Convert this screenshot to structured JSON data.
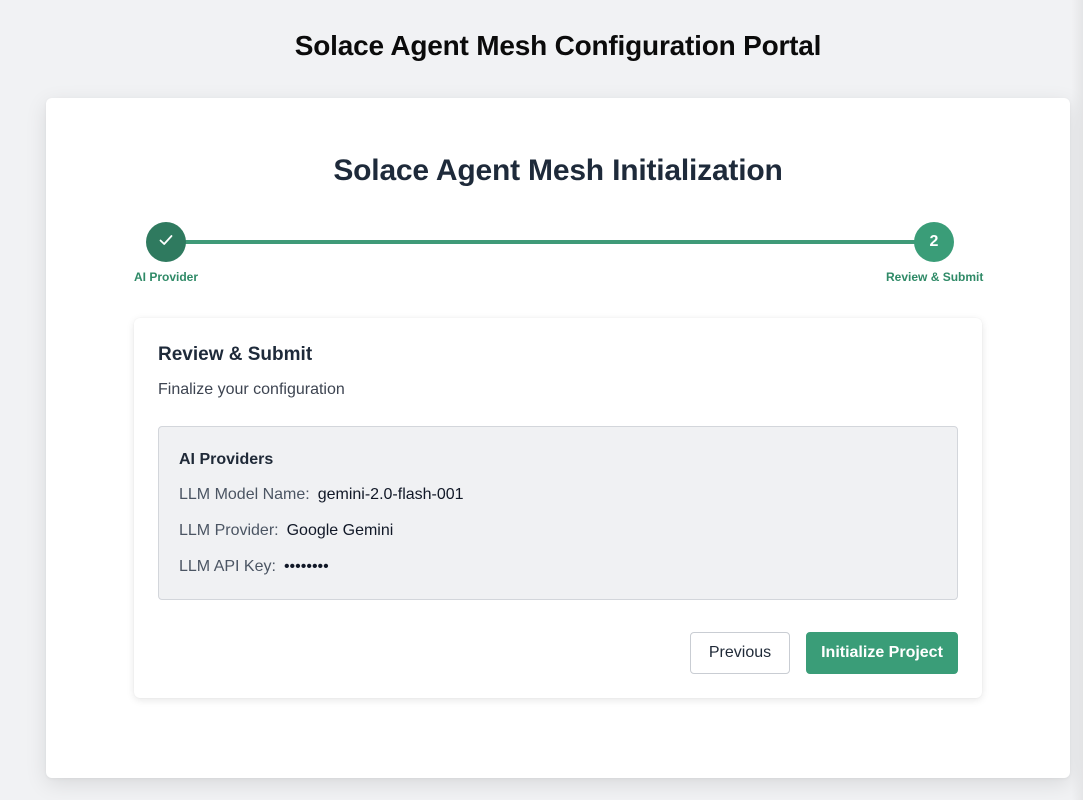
{
  "portal": {
    "title": "Solace Agent Mesh Configuration Portal"
  },
  "wizard": {
    "title": "Solace Agent Mesh Initialization",
    "steps": [
      {
        "label": "AI Provider",
        "status": "completed",
        "icon": "checkmark-icon"
      },
      {
        "label": "Review & Submit",
        "status": "current",
        "number": "2"
      }
    ]
  },
  "review": {
    "title": "Review & Submit",
    "subtitle": "Finalize your configuration",
    "section_title": "AI Providers",
    "fields": [
      {
        "key": "LLM Model Name:",
        "value": "gemini-2.0-flash-001"
      },
      {
        "key": "LLM Provider:",
        "value": "Google Gemini"
      },
      {
        "key": "LLM API Key:",
        "value": "••••••••"
      }
    ]
  },
  "actions": {
    "previous_label": "Previous",
    "submit_label": "Initialize Project"
  },
  "colors": {
    "accent": "#3a9d78",
    "completed_step": "#2f7a5f",
    "background": "#f1f2f4"
  }
}
